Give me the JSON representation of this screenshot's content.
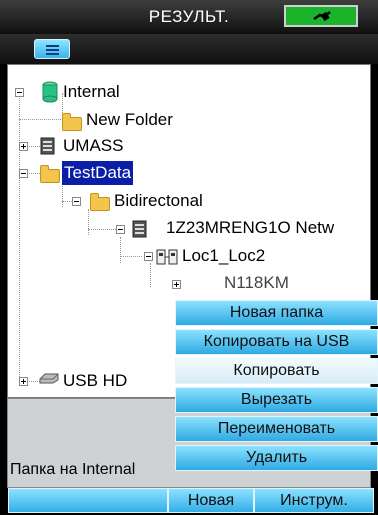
{
  "title": "РЕЗУЛЬТ.",
  "tree": {
    "internal": "Internal",
    "new_folder": "New Folder",
    "umass": "UMASS",
    "testdata": "TestData",
    "bidirectional": "Bidirectonal",
    "file1": "1Z23MRENG1O Netw",
    "loc": "Loc1_Loc2",
    "partial": "N118KM",
    "usb": "USB HD"
  },
  "status_text": "Папка на Internal",
  "context_menu": {
    "items": [
      "Новая папка",
      "Копировать на USB",
      "Копировать",
      "Вырезать",
      "Переименовать",
      "Удалить"
    ],
    "highlighted_index": 2
  },
  "softkeys": [
    "",
    "Новая",
    "Инструм."
  ],
  "colors": {
    "selection": "#0a1ea8",
    "battery": "#19b42b",
    "button": "#3bb3e8"
  }
}
